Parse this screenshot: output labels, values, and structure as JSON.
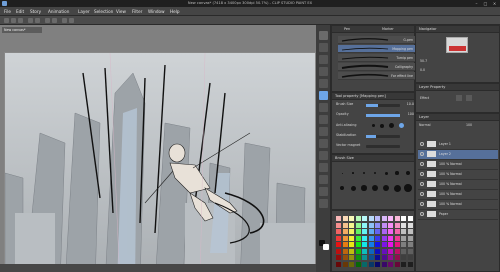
{
  "window": {
    "title": "New canvas* (7418 x 3400px 300dpi 50.7%) - CLIP STUDIO PAINT EX"
  },
  "menu": [
    "File",
    "Edit",
    "Story",
    "Animation",
    "Layer",
    "Selection",
    "View",
    "Filter",
    "Window",
    "Help"
  ],
  "canvas": {
    "tab_label": "New canvas*"
  },
  "sub_tool": {
    "tabs": [
      "Pen",
      "Marker"
    ],
    "brushes": [
      "G-pen",
      "Mapping pen",
      "Turnip pen",
      "Calligraphy",
      "For effect line"
    ]
  },
  "tool_property": {
    "header": "Tool property [Mapping pen]",
    "rows": [
      {
        "label": "Brush Size",
        "value": "10.0",
        "fraction": 0.35
      },
      {
        "label": "Opacity",
        "value": "100",
        "fraction": 1.0
      },
      {
        "label": "Anti-aliasing",
        "value": "",
        "fraction": 0.6
      },
      {
        "label": "Stabilization",
        "value": "",
        "fraction": 0.3
      },
      {
        "label": "Vector magnet",
        "value": "",
        "fraction": 0.0
      }
    ]
  },
  "brush_size": {
    "header": "Brush Size"
  },
  "navigator": {
    "header": "Navigator",
    "zoom": "50.7",
    "rotation": "0.0"
  },
  "layer_property": {
    "header": "Layer Property",
    "effect_label": "Effect"
  },
  "layers": {
    "header": "Layer",
    "blend_mode": "Normal",
    "opacity": "100",
    "items": [
      {
        "name": "Layer 1",
        "selected": false
      },
      {
        "name": "Layer 2",
        "selected": true
      },
      {
        "name": "100 % Normal",
        "selected": false
      },
      {
        "name": "100 % Normal",
        "selected": false
      },
      {
        "name": "100 % Normal",
        "selected": false
      },
      {
        "name": "100 % Normal",
        "selected": false
      },
      {
        "name": "100 % Normal",
        "selected": false
      },
      {
        "name": "Paper",
        "selected": false
      }
    ]
  },
  "colors": {
    "accent": "#6ea6e8",
    "panel": "#444444",
    "selected_layer": "#56709a"
  }
}
